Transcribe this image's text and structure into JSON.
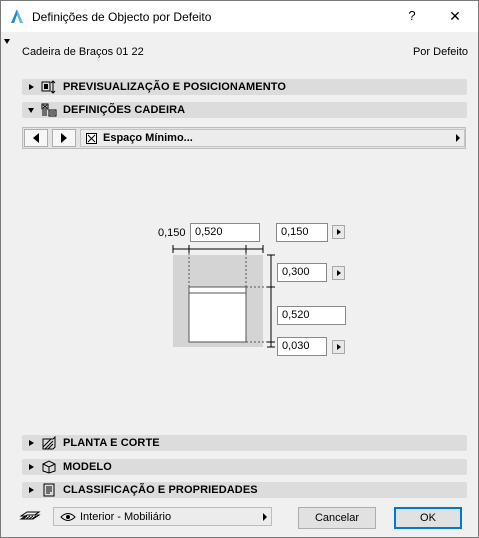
{
  "window": {
    "title": "Definições de Objecto por Defeito",
    "help": "?",
    "close": "✕"
  },
  "object": {
    "name": "Cadeira de Braços 01 22",
    "default_label": "Por Defeito"
  },
  "panels": {
    "preview": "PREVISUALIZAÇÃO E POSICIONAMENTO",
    "chair": "DEFINIÇÕES CADEIRA",
    "plan": "PLANTA E CORTE",
    "model": "MODELO",
    "classification": "CLASSIFICAÇÃO E PROPRIEDADES"
  },
  "page_selector": {
    "label": "Espaço Mínimo..."
  },
  "parameters": {
    "left_clearance": "0,150",
    "width": "0,520",
    "right_clearance": "0,150",
    "back_clearance": "0,300",
    "depth": "0,520",
    "front_clearance": "0,030"
  },
  "footer": {
    "layer": "Interior - Mobiliário",
    "cancel": "Cancelar",
    "ok": "OK"
  }
}
